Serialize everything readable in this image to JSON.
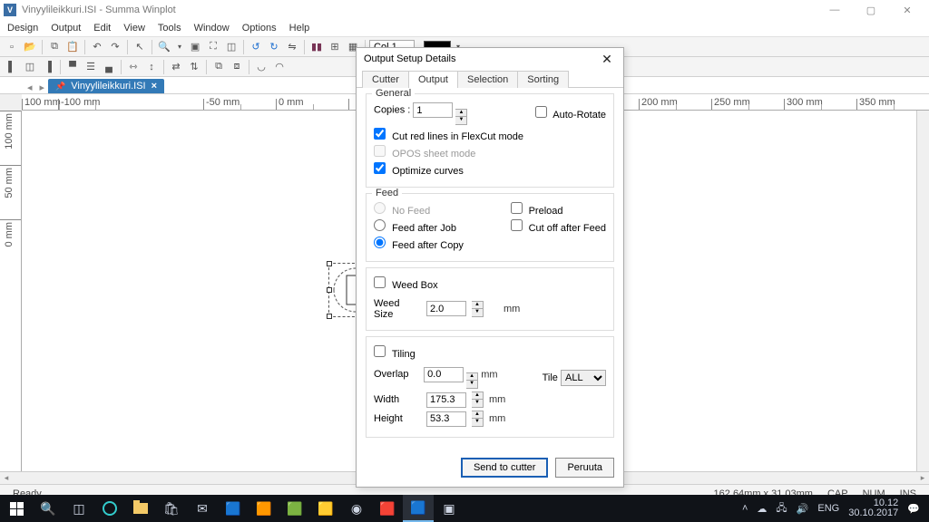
{
  "titlebar": {
    "filename": "Vinyylileikkuri.ISI",
    "appname": "Summa Winplot"
  },
  "menubar": [
    "Design",
    "Output",
    "Edit",
    "View",
    "Tools",
    "Window",
    "Options",
    "Help"
  ],
  "toolbar": {
    "col_label": "Col 1"
  },
  "filetab": {
    "name": "Vinyylileikkuri.ISI"
  },
  "ruler_h": [
    "100 mm",
    "-100 mm",
    "-50 mm",
    "0 mm",
    "",
    "200 mm",
    "250 mm",
    "300 mm",
    "350 mm"
  ],
  "ruler_v": [
    "100 mm",
    "50 mm",
    "0 mm"
  ],
  "dialog": {
    "title": "Output Setup Details",
    "tabs": [
      "Cutter",
      "Output",
      "Selection",
      "Sorting"
    ],
    "active_tab": "Output",
    "general": {
      "label": "General",
      "copies_label": "Copies :",
      "copies_value": "1",
      "auto_rotate": "Auto-Rotate",
      "cut_red": "Cut red lines in FlexCut mode",
      "opos": "OPOS sheet mode",
      "optimize": "Optimize curves"
    },
    "feed": {
      "label": "Feed",
      "no_feed": "No Feed",
      "after_job": "Feed after Job",
      "after_copy": "Feed after Copy",
      "preload": "Preload",
      "cutoff": "Cut off after Feed"
    },
    "weed": {
      "weed_box": "Weed Box",
      "size_label": "Weed Size",
      "size_value": "2.0",
      "unit": "mm"
    },
    "tiling": {
      "tiling": "Tiling",
      "overlap_label": "Overlap",
      "overlap_value": "0.0",
      "width_label": "Width",
      "width_value": "175.3",
      "height_label": "Height",
      "height_value": "53.3",
      "unit": "mm",
      "tile_label": "Tile",
      "tile_value": "ALL"
    },
    "buttons": {
      "send": "Send to cutter",
      "cancel": "Peruuta"
    }
  },
  "status": {
    "ready": "Ready",
    "coords": "162.64mm x 31.03mm",
    "cap": "CAP",
    "num": "NUM",
    "ins": "INS"
  },
  "taskbar": {
    "lang": "ENG",
    "time": "10.12",
    "date": "30.10.2017"
  }
}
